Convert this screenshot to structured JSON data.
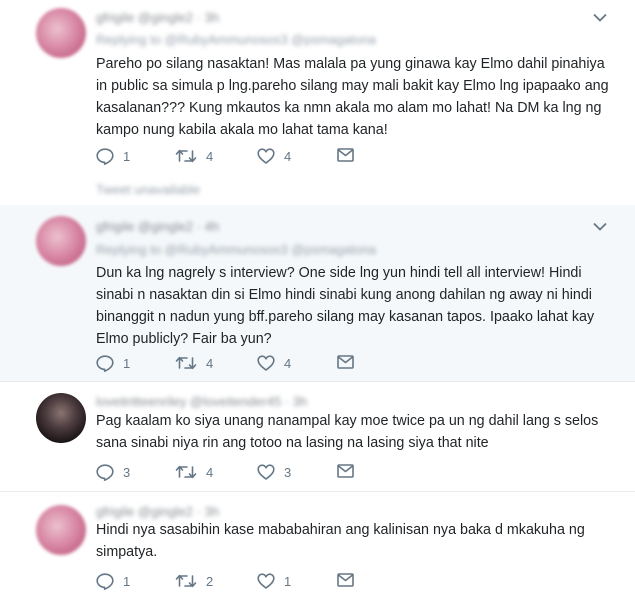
{
  "tweets": [
    {
      "header_blurred": "gfrigile @gingle2 · 3h",
      "reply_blurred": "Replying to @RubyAmmunosos3 @psmagatona",
      "text": "Pareho po silang nasaktan! Mas malala pa yung ginawa kay Elmo dahil pinahiya in public sa simula p lng.pareho silang may mali bakit kay Elmo lng ipapaako ang kasalanan??? Kung mkautos ka nmn akala mo alam mo lahat! Na DM ka lng ng kampo nung kabila akala mo lahat tama kana!",
      "replies": "1",
      "retweets": "4",
      "likes": "4"
    },
    {
      "header_blurred": "gfrigile @gingle2 · 4h",
      "reply_blurred": "Replying to @RubyAmmunosos3 @psmagatona",
      "text": "Dun ka lng nagrely s interview? One side lng yun hindi tell all interview! Hindi sinabi n nasaktan din si Elmo hindi sinabi kung anong dahilan ng away ni hindi binanggit n nadun yung bff.pareho silang may kasanan tapos. Ipaako lahat kay Elmo publicly? Fair ba yun?",
      "replies": "1",
      "retweets": "4",
      "likes": "4"
    },
    {
      "header_blurred": "loveitritteenriley @loveitender45 · 3h",
      "reply_blurred": "",
      "text": "Pag kaalam ko siya unang nanampal kay moe twice pa un ng dahil lang s selos sana sinabi niya rin ang totoo na lasing na lasing siya that nite",
      "replies": "3",
      "retweets": "4",
      "likes": "3"
    },
    {
      "header_blurred": "gfrigile @gingle2 · 3h",
      "reply_blurred": "",
      "text": "Hindi nya sasabihin kase mababahiran ang kalinisan nya baka d mkakuha ng simpatya.",
      "replies": "1",
      "retweets": "2",
      "likes": "1"
    }
  ],
  "unavailable_blurred": "Tweet unavailable",
  "icons": {
    "reply": "reply-icon",
    "retweet": "retweet-icon",
    "like": "heart-icon",
    "dm": "envelope-icon",
    "more": "chevron-down-icon"
  },
  "colors": {
    "icon": "#657786",
    "highlight_bg": "#f5f8fa",
    "divider": "#e6ecf0"
  }
}
